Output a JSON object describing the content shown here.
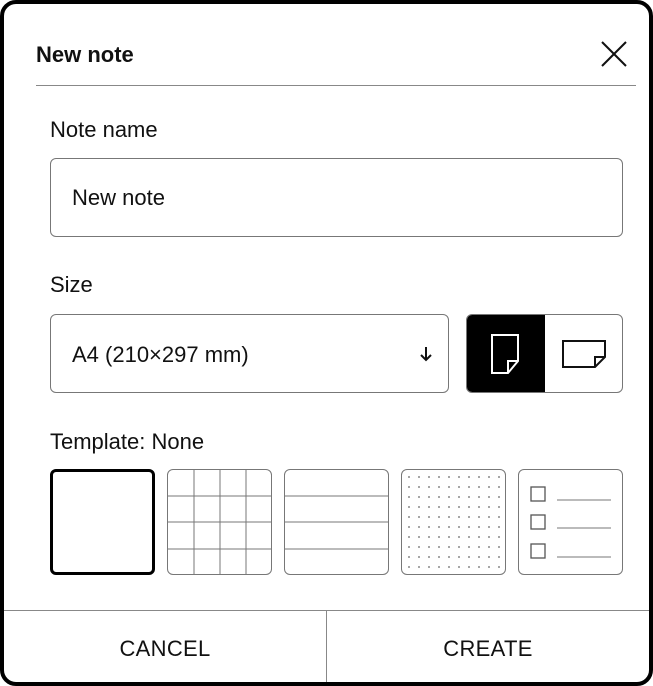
{
  "dialog": {
    "title": "New note",
    "close_icon": "close-x-icon"
  },
  "note_name": {
    "label": "Note name",
    "value": "New note"
  },
  "size": {
    "label": "Size",
    "selected": "A4 (210×297 mm)",
    "arrow_icon": "arrow-down-icon",
    "orientations": [
      {
        "name": "portrait",
        "icon": "portrait-page-icon",
        "active": true
      },
      {
        "name": "landscape",
        "icon": "landscape-page-icon",
        "active": false
      }
    ]
  },
  "template": {
    "label": "Template: None",
    "options": [
      {
        "icon": "blank-template-icon",
        "selected": true
      },
      {
        "icon": "grid-template-icon",
        "selected": false
      },
      {
        "icon": "lined-template-icon",
        "selected": false
      },
      {
        "icon": "dotted-template-icon",
        "selected": false
      },
      {
        "icon": "checklist-template-icon",
        "selected": false
      }
    ]
  },
  "footer": {
    "cancel_label": "CANCEL",
    "create_label": "CREATE"
  }
}
